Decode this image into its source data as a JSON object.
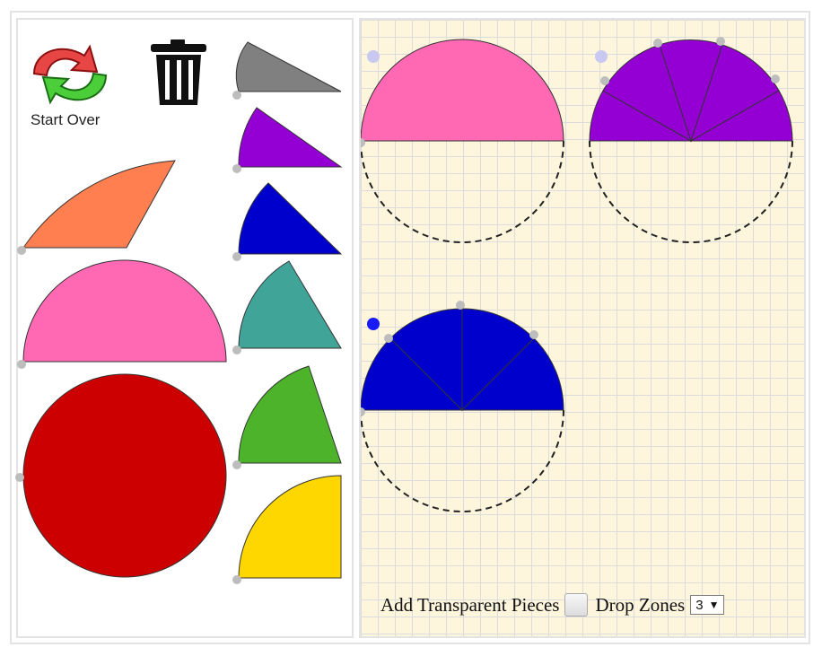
{
  "toolbar": {
    "start_over_label": "Start Over",
    "start_over_icon": "refresh-arrows-icon",
    "trash_icon": "trash-can-icon"
  },
  "controls": {
    "transparent_label": "Add Transparent Pieces",
    "transparent_checked": false,
    "drop_zones_label": "Drop Zones",
    "drop_zones_value": "3",
    "dropdown_arrow": "▼"
  },
  "colors": {
    "orange": "#ff7f50",
    "pink": "#ff69b4",
    "red": "#cc0000",
    "gray": "#808080",
    "purple": "#9400d3",
    "blue": "#0000cd",
    "teal": "#40a499",
    "green": "#4cb32a",
    "yellow": "#ffd700",
    "grid_background": "#fdf5dc",
    "grid_line": "#dcdcdc"
  }
}
